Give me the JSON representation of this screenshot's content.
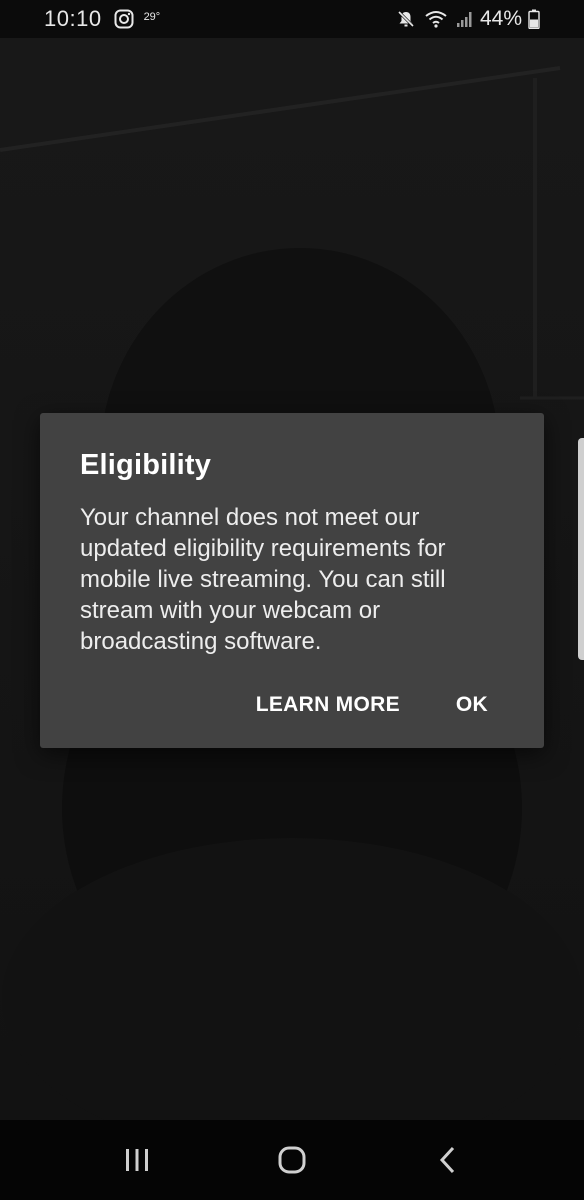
{
  "status_bar": {
    "time": "10:10",
    "temperature": "29°",
    "battery_percent": "44%",
    "icons": [
      "instagram-icon",
      "mute-icon",
      "wifi-icon",
      "signal-icon",
      "battery-icon"
    ]
  },
  "dialog": {
    "title": "Eligibility",
    "message": "Your channel does not meet our updated eligibility requirements for mobile live streaming. You can still stream with your webcam or broadcasting software.",
    "actions": {
      "learn_more": "LEARN MORE",
      "ok": "OK"
    }
  },
  "nav_bar": {
    "icons": [
      "recents-icon",
      "home-icon",
      "back-icon"
    ]
  },
  "colors": {
    "dialog_bg": "#424242",
    "screen_bg": "#151515",
    "text": "#ffffff"
  }
}
